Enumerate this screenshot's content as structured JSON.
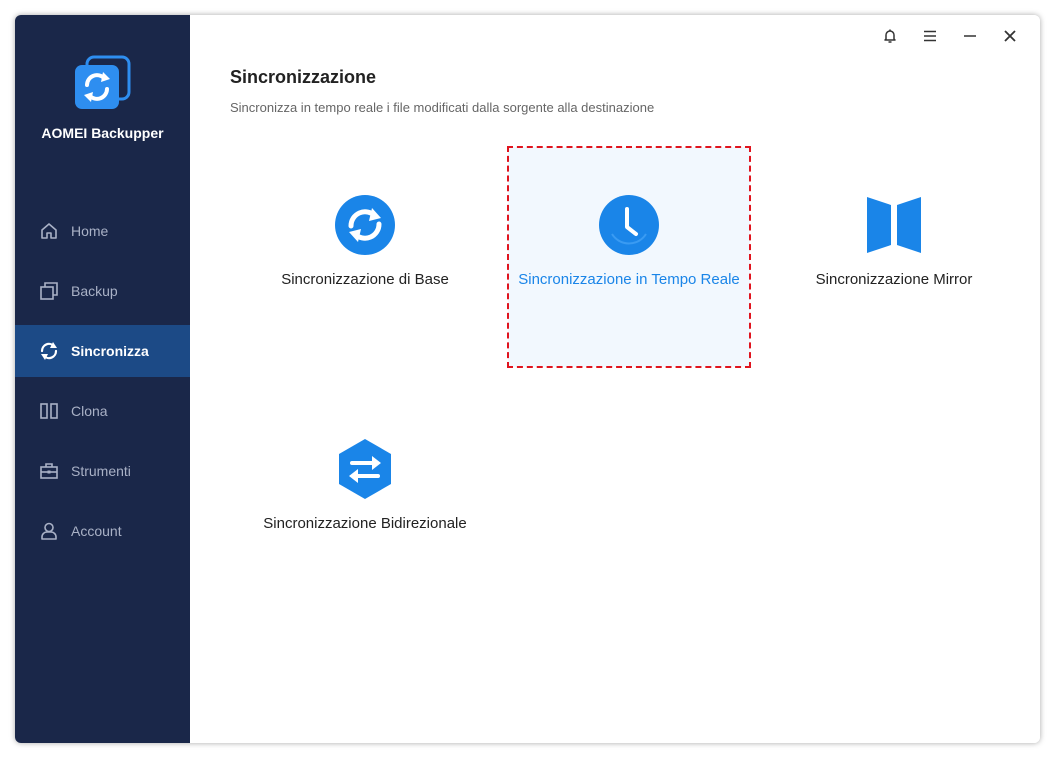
{
  "app": {
    "name": "AOMEI Backupper",
    "accent": "#1a85e8",
    "sidebar_bg": "#1a2749",
    "selection_border": "#e0141e"
  },
  "titlebar": {
    "icons": [
      "bell-icon",
      "menu-icon",
      "minimize-icon",
      "close-icon"
    ]
  },
  "sidebar": {
    "items": [
      {
        "label": "Home",
        "icon": "home-icon",
        "active": false
      },
      {
        "label": "Backup",
        "icon": "backup-icon",
        "active": false
      },
      {
        "label": "Sincronizza",
        "icon": "sync-icon",
        "active": true
      },
      {
        "label": "Clona",
        "icon": "clone-icon",
        "active": false
      },
      {
        "label": "Strumenti",
        "icon": "toolbox-icon",
        "active": false
      },
      {
        "label": "Account",
        "icon": "user-icon",
        "active": false
      }
    ]
  },
  "main": {
    "title": "Sincronizzazione",
    "subtitle": "Sincronizza in tempo reale i file modificati dalla sorgente alla destinazione",
    "options": [
      {
        "label": "Sincronizzazione di Base",
        "icon": "basic-sync-icon",
        "selected": false
      },
      {
        "label": "Sincronizzazione in Tempo Reale",
        "icon": "clock-icon",
        "selected": true
      },
      {
        "label": "Sincronizzazione Mirror",
        "icon": "mirror-icon",
        "selected": false
      },
      {
        "label": "Sincronizzazione Bidirezionale",
        "icon": "two-way-sync-icon",
        "selected": false
      }
    ]
  }
}
